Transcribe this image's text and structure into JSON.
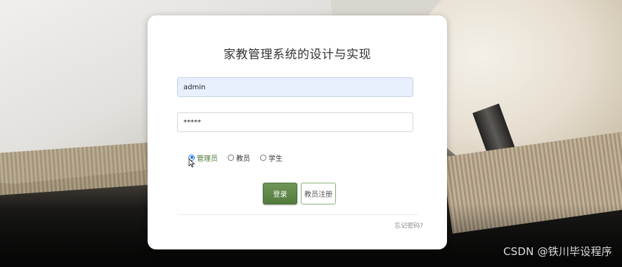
{
  "login": {
    "title": "家教管理系统的设计与实现",
    "username": {
      "value": "admin"
    },
    "password": {
      "value": "*****"
    },
    "roles": [
      {
        "label": "管理员",
        "checked": true
      },
      {
        "label": "教员",
        "checked": false
      },
      {
        "label": "学生",
        "checked": false
      }
    ],
    "login_button": "登录",
    "register_button": "教员注册",
    "forgot_link": "忘记密码?"
  },
  "watermark": "CSDN @铁川毕设程序",
  "colors": {
    "accent_green": "#527a3d",
    "autofill_bg": "#e8f0fe",
    "radio_checked": "#1a73e8"
  }
}
